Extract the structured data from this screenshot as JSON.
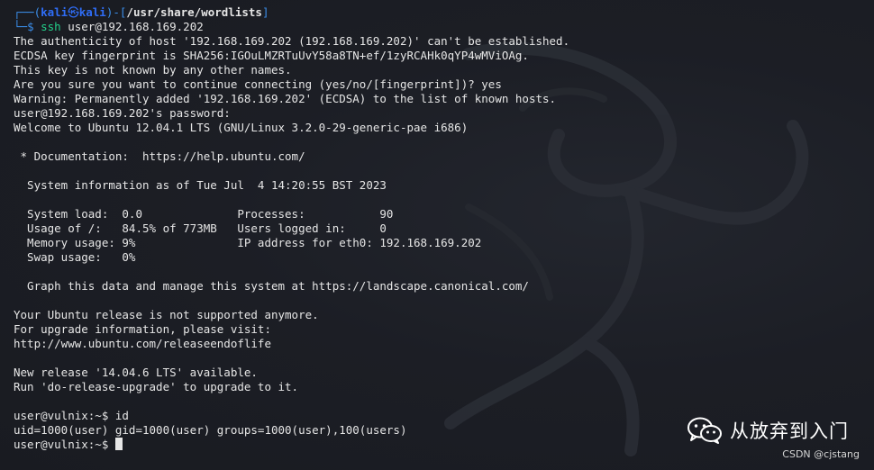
{
  "prompt": {
    "open_left": "┌──(",
    "user": "kali",
    "at_symbol": "㉿",
    "host": "kali",
    "sep": ")-[",
    "cwd": "/usr/share/wordlists",
    "close": "]",
    "second_prefix": "└─",
    "symbol": "$",
    "command_name": "ssh",
    "command_args": " user@192.168.169.202"
  },
  "output_lines": [
    "The authenticity of host '192.168.169.202 (192.168.169.202)' can't be established.",
    "ECDSA key fingerprint is SHA256:IGOuLMZRTuUvY58a8TN+ef/1zyRCAHk0qYP4wMViOAg.",
    "This key is not known by any other names.",
    "Are you sure you want to continue connecting (yes/no/[fingerprint])? yes",
    "Warning: Permanently added '192.168.169.202' (ECDSA) to the list of known hosts.",
    "user@192.168.169.202's password:",
    "Welcome to Ubuntu 12.04.1 LTS (GNU/Linux 3.2.0-29-generic-pae i686)",
    "",
    " * Documentation:  https://help.ubuntu.com/",
    "",
    "  System information as of Tue Jul  4 14:20:55 BST 2023",
    "",
    "  System load:  0.0              Processes:           90",
    "  Usage of /:   84.5% of 773MB   Users logged in:     0",
    "  Memory usage: 9%               IP address for eth0: 192.168.169.202",
    "  Swap usage:   0%",
    "",
    "  Graph this data and manage this system at https://landscape.canonical.com/",
    "",
    "Your Ubuntu release is not supported anymore.",
    "For upgrade information, please visit:",
    "http://www.ubuntu.com/releaseendoflife",
    "",
    "New release '14.04.6 LTS' available.",
    "Run 'do-release-upgrade' to upgrade to it.",
    "",
    "user@vulnix:~$ id",
    "uid=1000(user) gid=1000(user) groups=1000(user),100(users)"
  ],
  "final_prompt": "user@vulnix:~$ ",
  "watermark": {
    "wechat_name": "从放弃到入门",
    "csdn_credit": "CSDN @cjstang"
  },
  "colors": {
    "background": "#1b1d24",
    "text": "#e6e6e6",
    "prompt_blue": "#2f6df6",
    "command_green": "#23d18b"
  },
  "icons": {
    "wechat": "wechat-icon",
    "dragon": "kali-dragon-watermark"
  }
}
